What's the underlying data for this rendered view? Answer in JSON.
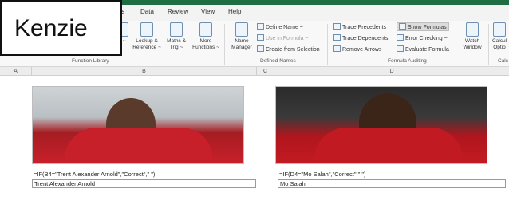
{
  "tabs": [
    "las",
    "Data",
    "Review",
    "View",
    "Help"
  ],
  "ribbon": {
    "left_partial": {
      "line1": "e ~",
      "line2": "Reference ~"
    },
    "lookup": {
      "line1": "Lookup &",
      "line2": "Reference ~"
    },
    "maths": {
      "line1": "Maths &",
      "line2": "Trig ~"
    },
    "more": {
      "line1": "More",
      "line2": "Functions ~"
    },
    "function_library_label": "Function Library",
    "name_manager": {
      "line1": "Name",
      "line2": "Manager"
    },
    "define_name": "Define Name ~",
    "use_in_formula": "Use in Formula ~",
    "create_from_selection": "Create from Selection",
    "defined_names_label": "Defined Names",
    "trace_precedents": "Trace Precedents",
    "trace_dependents": "Trace Dependents",
    "remove_arrows": "Remove Arrows ~",
    "show_formulas": "Show Formulas",
    "error_checking": "Error Checking ~",
    "evaluate_formula": "Evaluate Formula",
    "watch_window": {
      "line1": "Watch",
      "line2": "Window"
    },
    "formula_auditing_label": "Formula Auditing",
    "calc": {
      "line1": "Calcul",
      "line2": "Optio"
    },
    "calc_label": "Calc"
  },
  "columns": [
    "A",
    "B",
    "C",
    "D"
  ],
  "cells": {
    "formula_b": "=IF(B4=\"Trent Alexander Arnold\",\"Correct\",\" \")",
    "value_b": "Trent Alexander Arnold",
    "formula_d": "=IF(D4=\"Mo Salah\",\"Correct\",\" \")",
    "value_d": "Mo Salah"
  },
  "overlay": {
    "name": "Kenzie"
  },
  "colors": {
    "excel_green": "#1f6e43",
    "jersey_red": "#c8202a"
  }
}
